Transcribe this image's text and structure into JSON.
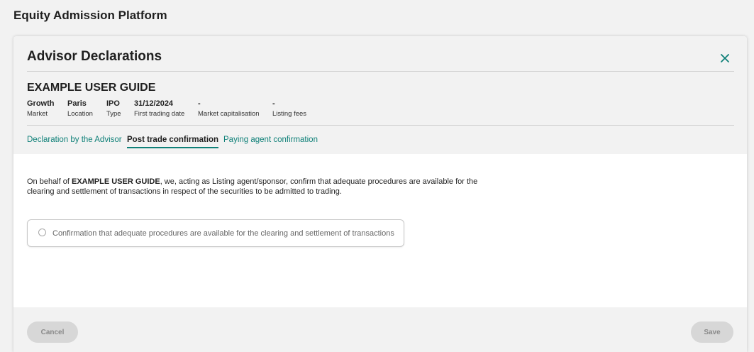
{
  "app": {
    "title": "Equity Admission Platform"
  },
  "dialog": {
    "title": "Advisor Declarations",
    "company_name": "EXAMPLE USER GUIDE",
    "meta": [
      {
        "value": "Growth",
        "label": "Market"
      },
      {
        "value": "Paris",
        "label": "Location"
      },
      {
        "value": "IPO",
        "label": "Type"
      },
      {
        "value": "31/12/2024",
        "label": "First trading date"
      },
      {
        "value": "-",
        "label": "Market capitalisation"
      },
      {
        "value": "-",
        "label": "Listing fees"
      }
    ],
    "tabs": [
      {
        "label": "Declaration by the Advisor",
        "active": false
      },
      {
        "label": "Post trade confirmation",
        "active": true
      },
      {
        "label": "Paying agent confirmation",
        "active": false
      }
    ]
  },
  "content": {
    "text_prefix": "On behalf of ",
    "text_company": "EXAMPLE USER GUIDE",
    "text_rest": ", we, acting as Listing agent/sponsor, confirm that adequate procedures are available for the clearing and settlement of transactions in respect of the securities to be admitted to trading.",
    "confirmation_label": "Confirmation that adequate procedures are available for the clearing and settlement of transactions",
    "confirmation_checked": false
  },
  "footer": {
    "cancel_label": "Cancel",
    "save_label": "Save"
  },
  "colors": {
    "accent": "#0f8078",
    "background": "#f2f2f2",
    "button_disabled": "#d7d7d7"
  },
  "icons": {
    "close": "close-icon",
    "radio": "radio-unchecked-icon"
  }
}
